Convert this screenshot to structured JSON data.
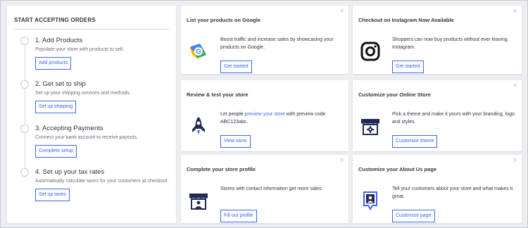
{
  "onboarding": {
    "heading": "START ACCEPTING ORDERS",
    "steps": [
      {
        "title": "1. Add Products",
        "desc": "Populate your store with products to sell.",
        "button": "Add products"
      },
      {
        "title": "2. Get set to ship",
        "desc": "Set up your shipping services and methods.",
        "button": "Set up shipping"
      },
      {
        "title": "3. Accepting Payments",
        "desc": "Connect your bank account to receive payouts.",
        "button": "Complete setup"
      },
      {
        "title": "4. Set up your tax rates",
        "desc": "Automatically calculate taxes for your customers at checkout.",
        "button": "Set up taxes"
      }
    ]
  },
  "cards": {
    "google": {
      "title": "List your products on Google",
      "text": "Boost traffic and increase sales by showcasing your products on Google.",
      "button": "Get started",
      "icon": "google-icon"
    },
    "instagram": {
      "title": "Checkout on Instagram Now Available",
      "text": "Shoppers can now buy products without ever leaving Instagram.",
      "button": "Get started",
      "icon": "instagram-icon"
    },
    "review": {
      "title": "Review & test your store",
      "text_before": "Let people ",
      "link": "preview your store",
      "text_after": " with preview code ABC123abc.",
      "button": "View store",
      "icon": "rocket-icon"
    },
    "customize": {
      "title": "Customize your Online Store",
      "text": "Pick a theme and make it yours with your branding, logo and styles.",
      "button": "Customize theme",
      "icon": "storefront-gear-icon"
    },
    "profile": {
      "title": "Complete your store profile",
      "text": "Stores with contact information get more sales.",
      "button": "Fill out profile",
      "icon": "storefront-person-icon"
    },
    "about": {
      "title": "Customize your About Us page",
      "text": "Tell your customers about your store and what makes it great.",
      "button": "Customize page",
      "icon": "person-badge-icon"
    }
  },
  "close_glyph": "×",
  "colors": {
    "accent": "#3c64f4",
    "dark_icon": "#242a4d",
    "background": "#eceef2"
  }
}
